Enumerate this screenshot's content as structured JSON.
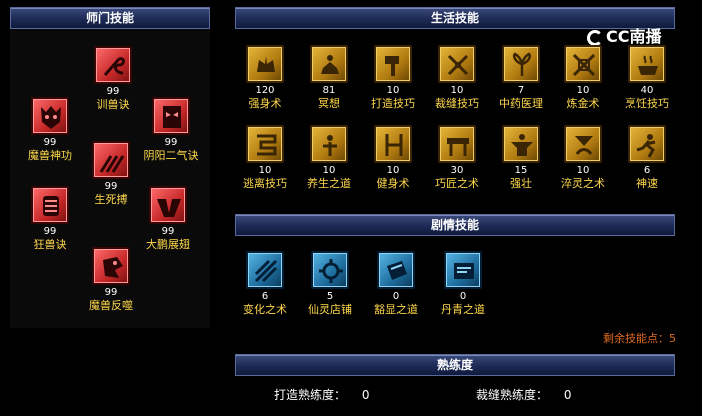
{
  "headers": {
    "school": "师门技能",
    "life": "生活技能",
    "story": "剧情技能",
    "proficiency": "熟练度"
  },
  "watermark": "CC南播",
  "school_skills": [
    {
      "level": "99",
      "name": "训兽诀",
      "icon": "whip-icon"
    },
    {
      "level": "99",
      "name": "魔兽神功",
      "icon": "beast-face-icon"
    },
    {
      "level": "99",
      "name": "阴阳二气诀",
      "icon": "mask-icon"
    },
    {
      "level": "99",
      "name": "生死搏",
      "icon": "claw-icon"
    },
    {
      "level": "99",
      "name": "狂兽诀",
      "icon": "skull-icon"
    },
    {
      "level": "99",
      "name": "大鹏展翅",
      "icon": "wings-icon"
    },
    {
      "level": "99",
      "name": "魔兽反噬",
      "icon": "roar-icon"
    }
  ],
  "life_skills": [
    {
      "level": "120",
      "name": "强身术",
      "icon": "muscle-icon"
    },
    {
      "level": "81",
      "name": "冥想",
      "icon": "meditate-icon"
    },
    {
      "level": "10",
      "name": "打造技巧",
      "icon": "hammer-icon"
    },
    {
      "level": "10",
      "name": "裁缝技巧",
      "icon": "scissors-icon"
    },
    {
      "level": "7",
      "name": "中药医理",
      "icon": "herb-icon"
    },
    {
      "level": "10",
      "name": "炼金术",
      "icon": "alchemy-icon"
    },
    {
      "level": "40",
      "name": "烹饪技巧",
      "icon": "cooking-icon"
    },
    {
      "level": "10",
      "name": "逃离技巧",
      "icon": "escape-icon"
    },
    {
      "level": "10",
      "name": "养生之道",
      "icon": "health-icon"
    },
    {
      "level": "10",
      "name": "健身术",
      "icon": "fitness-icon"
    },
    {
      "level": "30",
      "name": "巧匠之术",
      "icon": "craftsman-icon"
    },
    {
      "level": "15",
      "name": "强壮",
      "icon": "strength-icon"
    },
    {
      "level": "10",
      "name": "淬灵之术",
      "icon": "temper-icon"
    },
    {
      "level": "6",
      "name": "神速",
      "icon": "speed-icon"
    }
  ],
  "story_skills": [
    {
      "level": "6",
      "name": "变化之术",
      "icon": "transform-icon"
    },
    {
      "level": "5",
      "name": "仙灵店铺",
      "icon": "shop-icon"
    },
    {
      "level": "0",
      "name": "豁显之道",
      "icon": "book-icon"
    },
    {
      "level": "0",
      "name": "丹青之道",
      "icon": "scroll-icon"
    }
  ],
  "remaining_points": "剩余技能点：5",
  "proficiency": {
    "forge_label": "打造熟练度：",
    "forge_value": "0",
    "tailor_label": "裁缝熟练度：",
    "tailor_value": "0"
  }
}
